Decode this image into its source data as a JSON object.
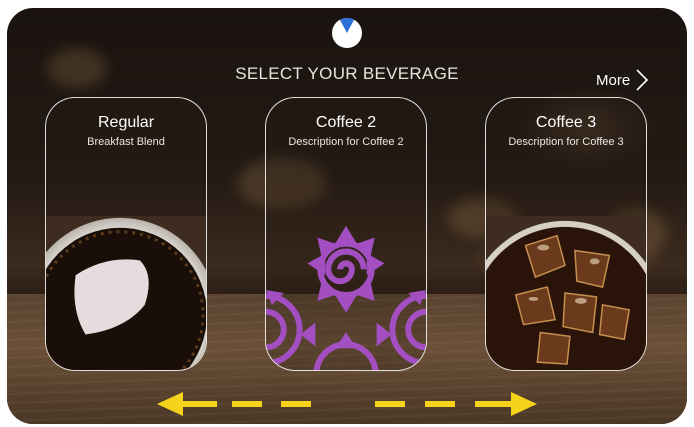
{
  "header": {
    "logo_icon": "brand-logo-icon",
    "title": "SELECT YOUR BEVERAGE",
    "more_label": "More",
    "more_icon": "chevron-right-icon"
  },
  "beverages": [
    {
      "name": "Regular",
      "description": "Breakfast Blend",
      "image": "black-coffee-cup"
    },
    {
      "name": "Coffee 2",
      "description": "Description for Coffee 2",
      "image": "purple-spiral-pattern"
    },
    {
      "name": "Coffee 3",
      "description": "Description for Coffee 3",
      "image": "iced-coffee-glass"
    }
  ],
  "footer": {
    "left_arrow_icon": "arrow-left-icon",
    "right_arrow_icon": "arrow-right-icon"
  },
  "colors": {
    "accent": "#f5d21c",
    "logo_blue": "#2e6fd8",
    "pattern_purple": "#a34fc2"
  }
}
